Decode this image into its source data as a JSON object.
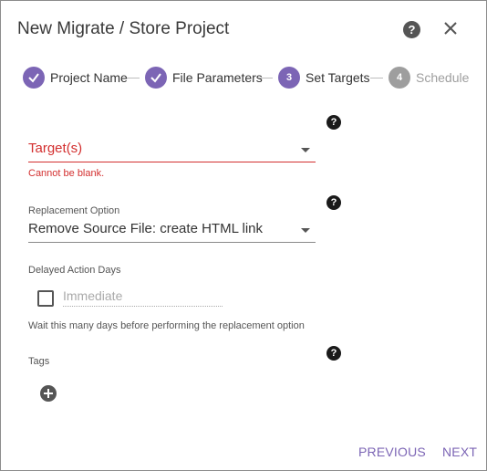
{
  "dialog": {
    "title": "New Migrate / Store Project"
  },
  "stepper": {
    "steps": [
      {
        "number": "✓",
        "label": "Project Name",
        "state": "done"
      },
      {
        "number": "✓",
        "label": "File Parameters",
        "state": "done"
      },
      {
        "number": "3",
        "label": "Set Targets",
        "state": "active"
      },
      {
        "number": "4",
        "label": "Schedule",
        "state": "pending"
      }
    ]
  },
  "form": {
    "targets": {
      "value": "Target(s)",
      "error": "Cannot be blank."
    },
    "replacement": {
      "label": "Replacement Option",
      "value": "Remove Source File: create HTML link"
    },
    "delayed": {
      "label": "Delayed Action Days",
      "placeholder": "Immediate",
      "hint": "Wait this many days before performing the replacement option"
    },
    "tags": {
      "label": "Tags"
    }
  },
  "footer": {
    "previous_label": "PREVIOUS",
    "next_label": "NEXT"
  },
  "icons": {
    "help": "?",
    "accent_color": "#7c65b5",
    "error_color": "#d32f2f"
  }
}
